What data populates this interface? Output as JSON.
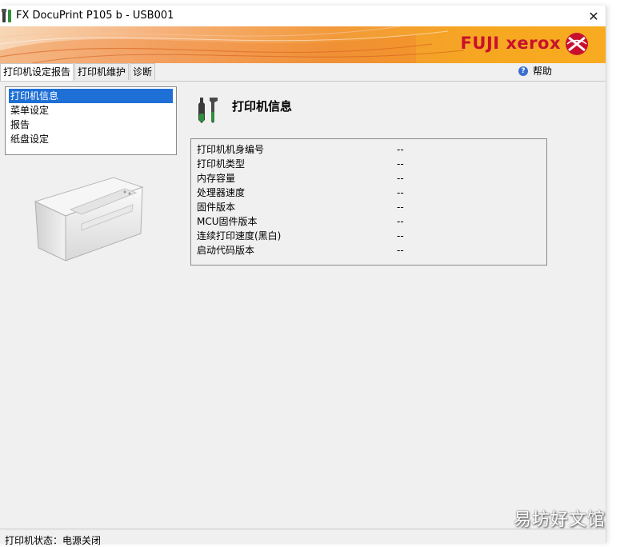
{
  "window": {
    "title": "FX DocuPrint P105 b - USB001",
    "close_glyph": "✕"
  },
  "banner": {
    "brand": "FUJI xerox"
  },
  "tabs": [
    {
      "label": "打印机设定报告",
      "active": true
    },
    {
      "label": "打印机维护",
      "active": false
    },
    {
      "label": "诊断",
      "active": false
    }
  ],
  "help": {
    "icon_glyph": "?",
    "label": "帮助"
  },
  "menu": {
    "items": [
      {
        "label": "打印机信息",
        "selected": true
      },
      {
        "label": "菜单设定",
        "selected": false
      },
      {
        "label": "报告",
        "selected": false
      },
      {
        "label": "纸盘设定",
        "selected": false
      }
    ]
  },
  "page": {
    "title": "打印机信息"
  },
  "info": {
    "rows": [
      {
        "label": "打印机机身编号",
        "value": "--"
      },
      {
        "label": "打印机类型",
        "value": "--"
      },
      {
        "label": "内存容量",
        "value": "--"
      },
      {
        "label": "处理器速度",
        "value": "--"
      },
      {
        "label": "固件版本",
        "value": "--"
      },
      {
        "label": "MCU固件版本",
        "value": "--"
      },
      {
        "label": "连续打印速度(黑白)",
        "value": "--"
      },
      {
        "label": "启动代码版本",
        "value": "--"
      }
    ]
  },
  "status": {
    "text": "打印机状态：电源关闭"
  },
  "watermark": {
    "text": "易坊好文馆"
  },
  "colors": {
    "accent": "#1e6fd6",
    "brand_red": "#c8102e",
    "banner_orange": "#f29a3b"
  },
  "icons": {
    "app": "printer-tools-icon",
    "page": "tools-icon",
    "help": "help-icon",
    "brand": "xerox-sphere-icon"
  }
}
